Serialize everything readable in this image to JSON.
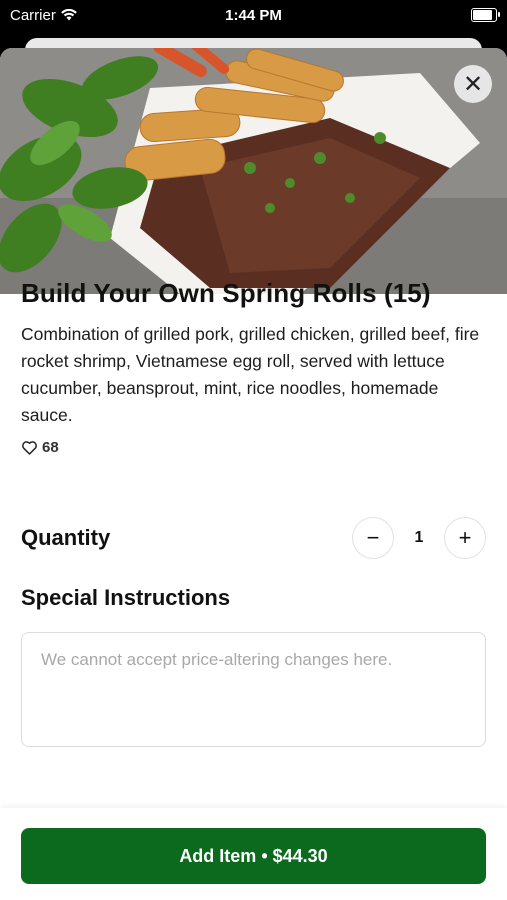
{
  "status_bar": {
    "carrier": "Carrier",
    "time": "1:44 PM"
  },
  "item": {
    "title": "Build Your Own Spring Rolls (15)",
    "description": "Combination of grilled pork, grilled chicken, grilled beef, fire rocket shrimp, Vietnamese egg roll, served with lettuce cucumber, beansprout, mint, rice noodles, homemade sauce.",
    "likes": "68"
  },
  "quantity": {
    "label": "Quantity",
    "value": "1",
    "minus": "−",
    "plus": "+"
  },
  "instructions": {
    "label": "Special Instructions",
    "placeholder": "We cannot accept price-altering changes here."
  },
  "footer": {
    "add_label": "Add Item • $44.30"
  },
  "colors": {
    "accent": "#0b6a1d"
  },
  "icons": {
    "close": "close-icon",
    "heart": "heart-icon"
  }
}
